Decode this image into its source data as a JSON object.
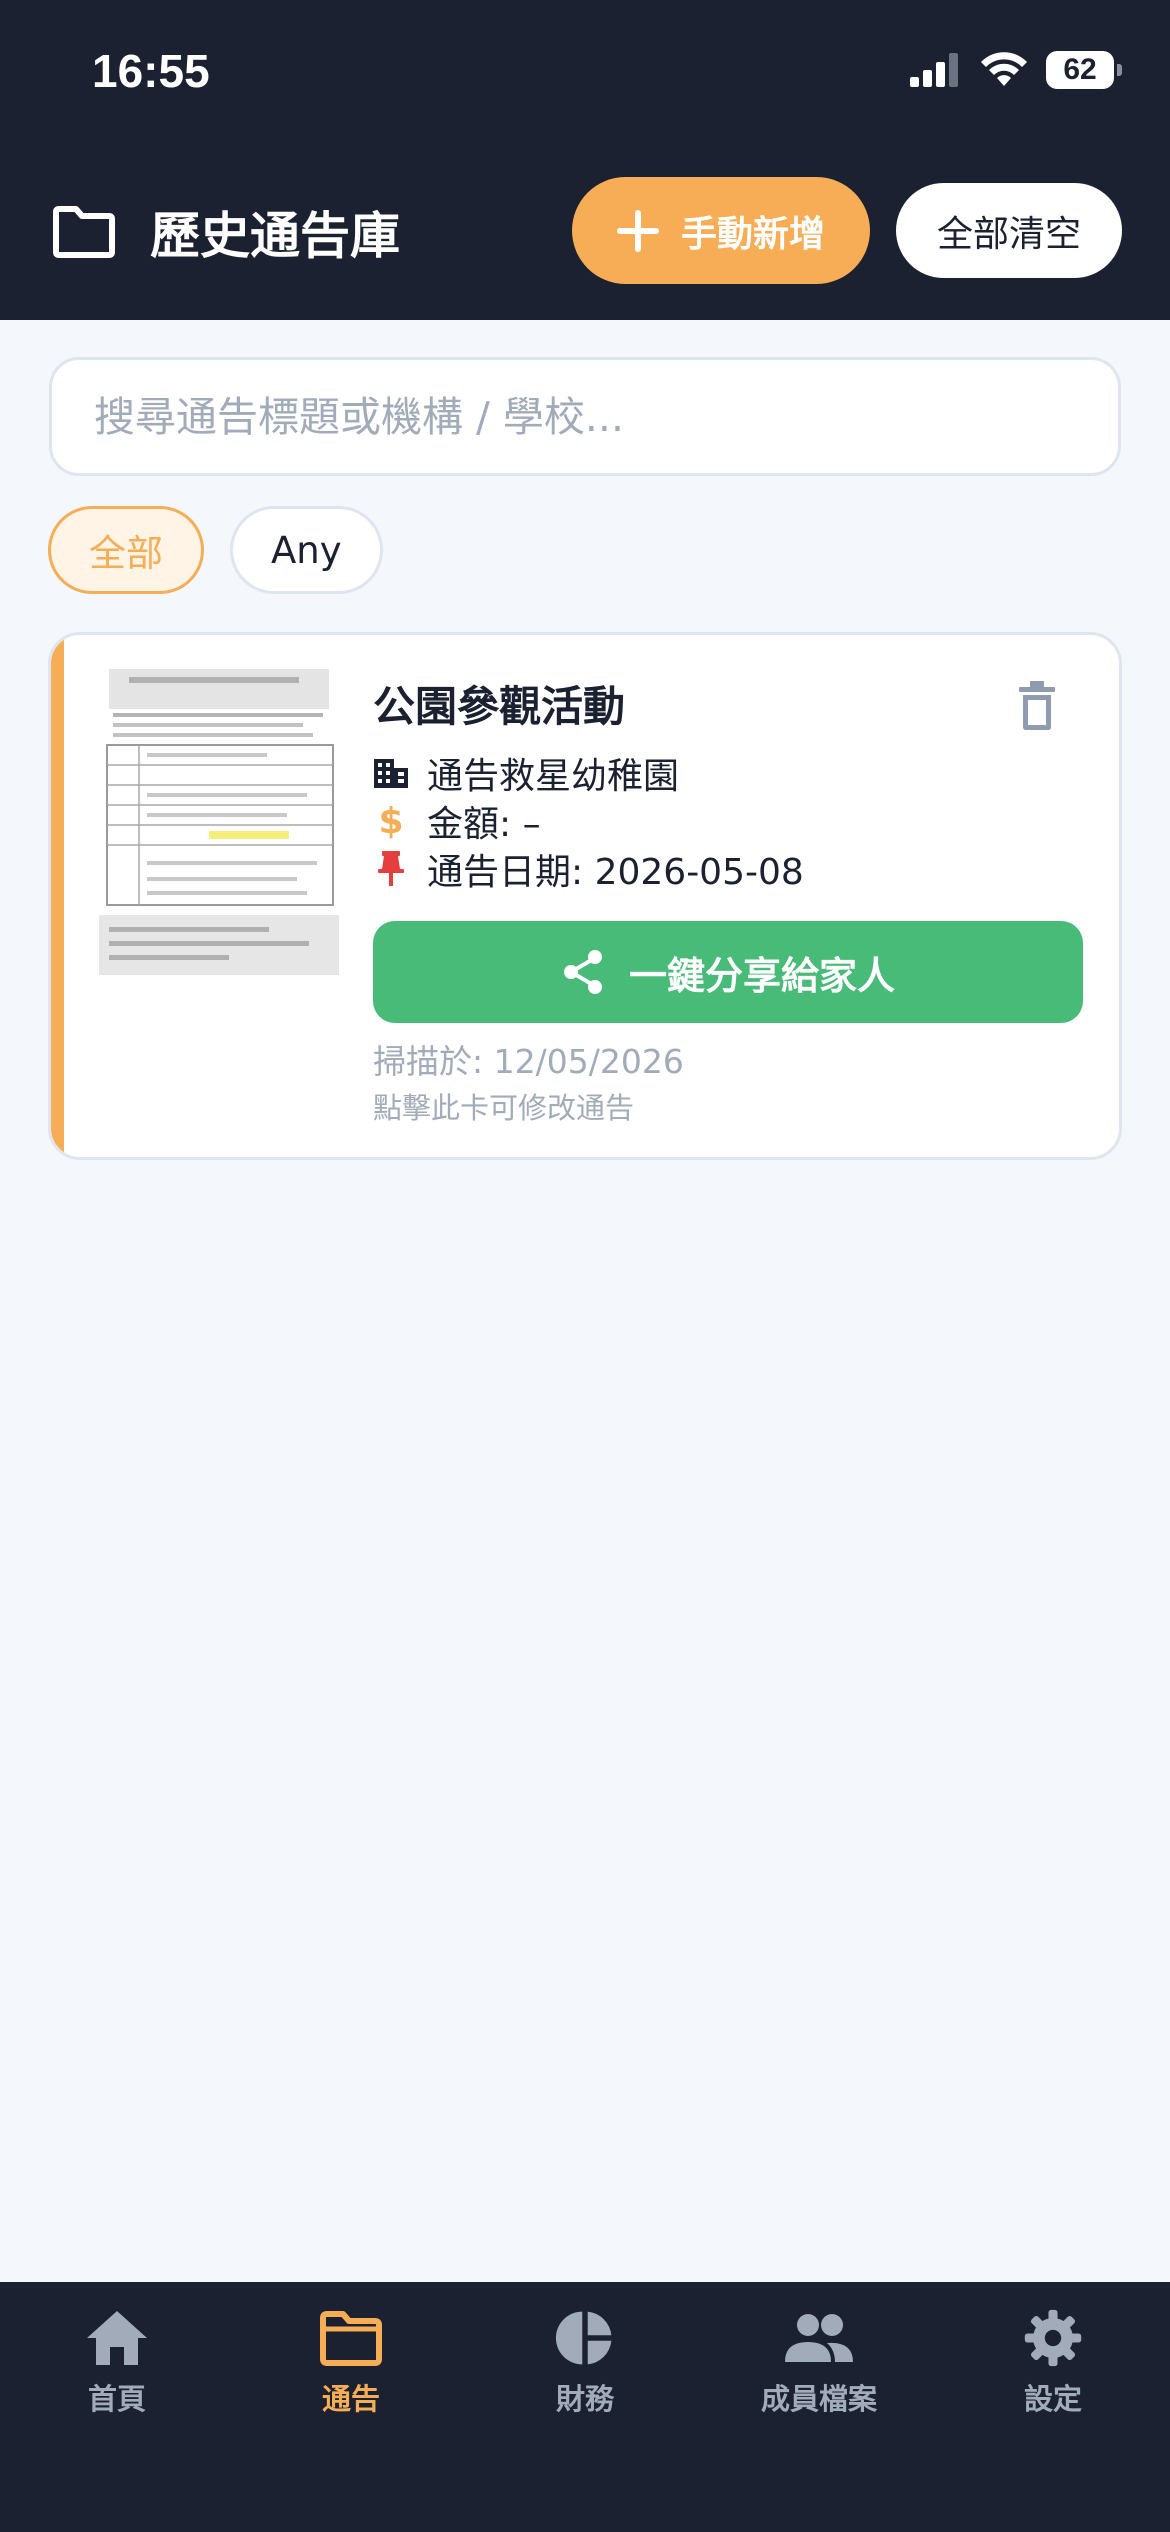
{
  "status_bar": {
    "time": "16:55",
    "battery": "62"
  },
  "header": {
    "title": "歷史通告庫",
    "add_button": "手動新增",
    "clear_button": "全部清空"
  },
  "search": {
    "placeholder": "搜尋通告標題或機構 / 學校...",
    "value": ""
  },
  "filters": [
    {
      "label": "全部",
      "selected": true
    },
    {
      "label": "Any",
      "selected": false
    }
  ],
  "notices": [
    {
      "title": "公園參觀活動",
      "organization": "通告救星幼稚園",
      "amount": "金額: –",
      "notice_date": "通告日期: 2026-05-08",
      "share_button": "一鍵分享給家人",
      "scanned_at": "掃描於: 12/05/2026",
      "edit_hint": "點擊此卡可修改通告"
    }
  ],
  "bottom_nav": [
    {
      "label": "首頁",
      "icon": "home-icon",
      "active": false
    },
    {
      "label": "通告",
      "icon": "folder-icon",
      "active": true
    },
    {
      "label": "財務",
      "icon": "pie-chart-icon",
      "active": false
    },
    {
      "label": "成員檔案",
      "icon": "people-icon",
      "active": false
    },
    {
      "label": "設定",
      "icon": "gear-icon",
      "active": false
    }
  ],
  "colors": {
    "dark_bg": "#1b2130",
    "accent_orange": "#f6ad55",
    "share_green": "#48bb78",
    "muted_text": "#a2abb9",
    "page_bg": "#f4f7fb"
  }
}
